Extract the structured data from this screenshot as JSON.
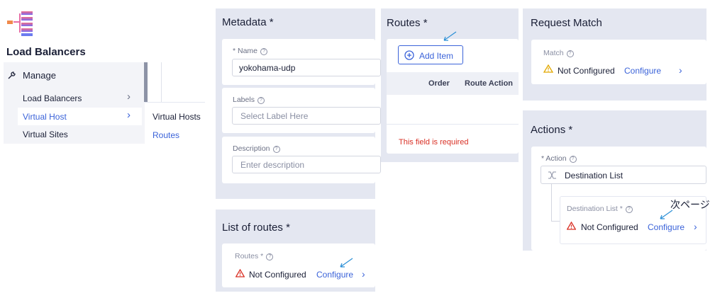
{
  "sidebar": {
    "title": "Load Balancers",
    "manage_label": "Manage",
    "items": [
      {
        "label": "Load Balancers",
        "chevron": "›"
      },
      {
        "label": "Virtual Host",
        "chevron": "›"
      },
      {
        "label": "Virtual Sites"
      }
    ],
    "submenu": [
      "Virtual Hosts",
      "Routes"
    ]
  },
  "metadata": {
    "title": "Metadata",
    "req": "*",
    "name_label": "* Name",
    "name_value": "yokohama-udp",
    "labels_label": "Labels",
    "labels_placeholder": "Select Label Here",
    "desc_label": "Description",
    "desc_placeholder": "Enter description"
  },
  "list_of_routes": {
    "title": "List of routes",
    "req": "*",
    "field_label": "Routes *",
    "status": "Not Configured",
    "configure": "Configure"
  },
  "routes": {
    "title": "Routes",
    "req": "*",
    "add_item": "Add Item",
    "col_order": "Order",
    "col_action": "Route Action",
    "error": "This field is required"
  },
  "request_match": {
    "title": "Request Match",
    "match_label": "Match",
    "status": "Not Configured",
    "configure": "Configure"
  },
  "actions": {
    "title": "Actions",
    "req": "*",
    "action_label": "* Action",
    "action_value": "Destination List",
    "dest_label": "Destination List *",
    "status": "Not Configured",
    "configure": "Configure",
    "annotation": "次ページ"
  },
  "colors": {
    "accent": "#3b63d9",
    "error": "#d93025",
    "arrow": "#2a8fd6",
    "panel": "#e4e7f1"
  }
}
